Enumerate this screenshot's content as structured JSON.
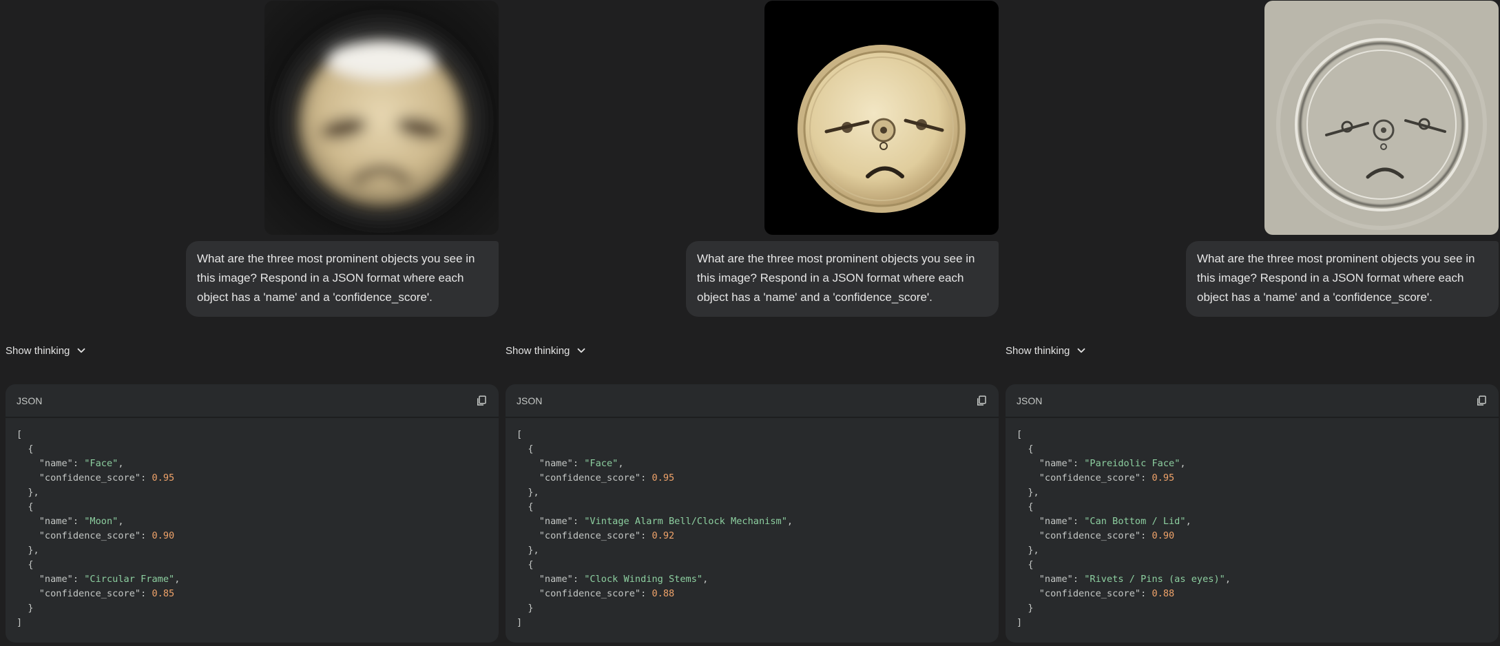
{
  "panels": [
    {
      "prompt": "What are the three most prominent objects you see in this image? Respond in a JSON format where each object has a 'name' and a 'confidence_score'.",
      "show_thinking": "Show thinking",
      "code_lang": "JSON",
      "items": [
        {
          "name": "Face",
          "score": "0.95"
        },
        {
          "name": "Moon",
          "score": "0.90"
        },
        {
          "name": "Circular Frame",
          "score": "0.85"
        }
      ]
    },
    {
      "prompt": "What are the three most prominent objects you see in this image? Respond in a JSON format where each object has a 'name' and a 'confidence_score'.",
      "show_thinking": "Show thinking",
      "code_lang": "JSON",
      "items": [
        {
          "name": "Face",
          "score": "0.95"
        },
        {
          "name": "Vintage Alarm Bell/Clock Mechanism",
          "score": "0.92"
        },
        {
          "name": "Clock Winding Stems",
          "score": "0.88"
        }
      ]
    },
    {
      "prompt": "What are the three most prominent objects you see in this image? Respond in a JSON format where each object has a 'name' and a 'confidence_score'.",
      "show_thinking": "Show thinking",
      "code_lang": "JSON",
      "items": [
        {
          "name": "Pareidolic Face",
          "score": "0.95"
        },
        {
          "name": "Can Bottom / Lid",
          "score": "0.90"
        },
        {
          "name": "Rivets / Pins (as eyes)",
          "score": "0.88"
        }
      ]
    }
  ],
  "json_syntax": {
    "open_bracket": "[",
    "close_bracket": "]",
    "open_brace": "{",
    "close_brace": "}",
    "close_brace_comma": "},",
    "name_key": "\"name\"",
    "score_key": "\"confidence_score\"",
    "colon": ": ",
    "comma": ","
  },
  "icons": {
    "chevron": "chevron-down-icon",
    "copy": "copy-icon"
  },
  "colors": {
    "background": "#1f1f20",
    "bubble": "#2f3032",
    "code_card": "#282a2c",
    "string": "#8dcfa0",
    "number": "#f0a36a"
  }
}
